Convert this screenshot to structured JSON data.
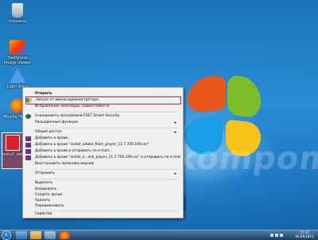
{
  "desktop": {
    "watermark": "skompom.ru",
    "icons": [
      {
        "name": "recycle-bin",
        "label": "Корзина"
      },
      {
        "name": "faststone",
        "label": "FastStone Image Viewer"
      },
      {
        "name": "lightalloy",
        "label": "Light Alloy"
      },
      {
        "name": "firefox",
        "label": "Mozilla Firefox"
      },
      {
        "name": "installer",
        "label": "install_adobe_flash_player_1...exe"
      }
    ]
  },
  "context_menu": {
    "items": [
      {
        "label": "Открыть",
        "bold": true
      },
      {
        "label": "Запуск от имени администратора",
        "icon": "shield-icon",
        "highlighted": true
      },
      {
        "label": "Исправление неполадок совместимости"
      },
      {
        "label": "Сканировать программой ESET Smart Security",
        "icon": "eset-icon"
      },
      {
        "label": "Расширенные функции",
        "submenu": true
      },
      {
        "label": "Общий доступ",
        "submenu": true
      },
      {
        "label": "Добавить в архив...",
        "icon": "winrar-icon"
      },
      {
        "label": "Добавить в архив \"install_adobe_flash_player_11.7.700.169.rar\"",
        "icon": "winrar-icon"
      },
      {
        "label": "Добавить в архив и отправить по e-mail...",
        "icon": "winrar-icon"
      },
      {
        "label": "Добавить в архив \"install_a...ash_player_11.7.700.169.rar\" и отправить по e-mail",
        "icon": "winrar-icon"
      },
      {
        "label": "Восстановить прежнюю версию"
      },
      {
        "label": "Отправить",
        "submenu": true
      },
      {
        "label": "Вырезать"
      },
      {
        "label": "Копировать"
      },
      {
        "label": "Создать ярлык"
      },
      {
        "label": "Удалить"
      },
      {
        "label": "Переименовать"
      },
      {
        "label": "Свойства"
      }
    ],
    "highlight_color": "#cc1f1f"
  },
  "taskbar": {
    "time": "21:37",
    "date": "04.09.2013"
  }
}
